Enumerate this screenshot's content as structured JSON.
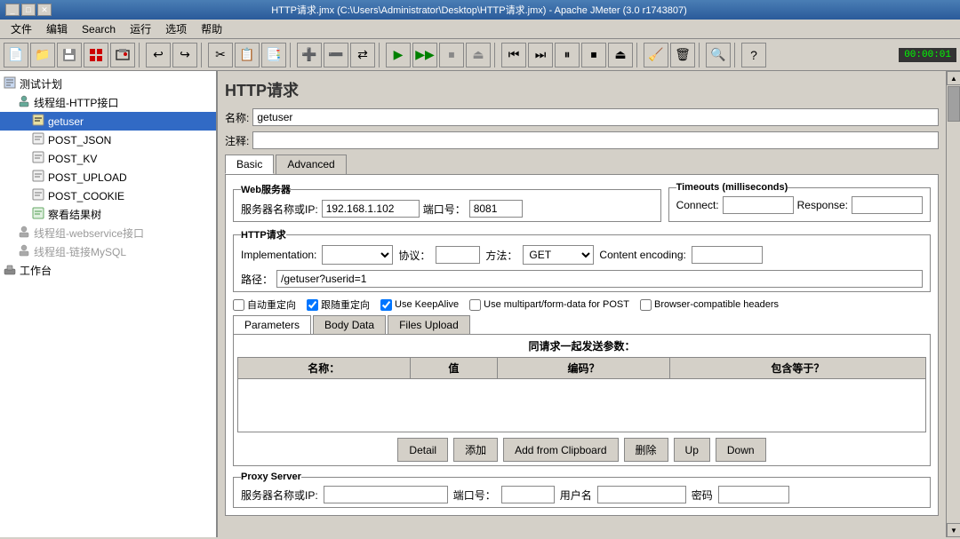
{
  "titleBar": {
    "text": "HTTP请求.jmx (C:\\Users\\Administrator\\Desktop\\HTTP请求.jmx) - Apache JMeter (3.0 r1743807)"
  },
  "menuBar": {
    "items": [
      "文件",
      "编辑",
      "Search",
      "运行",
      "选项",
      "帮助"
    ]
  },
  "toolbar": {
    "timer": "00:00:01",
    "buttons": [
      "📄",
      "💾",
      "⬆",
      "💾",
      "🖥",
      "↩",
      "↪",
      "✂",
      "📋",
      "📑",
      "➕",
      "➖",
      "⇄",
      "▶",
      "▶▶",
      "⏸",
      "⏹",
      "⏩",
      "⏮",
      "⏭",
      "⏸⏹",
      "🔍",
      "🔎",
      "📚",
      "🔑",
      "?"
    ]
  },
  "tree": {
    "nodes": [
      {
        "label": "测试计划",
        "indent": 0,
        "icon": "📋",
        "selected": false,
        "disabled": false
      },
      {
        "label": "线程组-HTTP接口",
        "indent": 1,
        "icon": "👥",
        "selected": false,
        "disabled": false
      },
      {
        "label": "getuser",
        "indent": 2,
        "icon": "📝",
        "selected": true,
        "disabled": false
      },
      {
        "label": "POST_JSON",
        "indent": 2,
        "icon": "📝",
        "selected": false,
        "disabled": false
      },
      {
        "label": "POST_KV",
        "indent": 2,
        "icon": "📝",
        "selected": false,
        "disabled": false
      },
      {
        "label": "POST_UPLOAD",
        "indent": 2,
        "icon": "📝",
        "selected": false,
        "disabled": false
      },
      {
        "label": "POST_COOKIE",
        "indent": 2,
        "icon": "📝",
        "selected": false,
        "disabled": false
      },
      {
        "label": "察看结果树",
        "indent": 2,
        "icon": "🌿",
        "selected": false,
        "disabled": false
      },
      {
        "label": "线程组-webservice接口",
        "indent": 1,
        "icon": "👥",
        "selected": false,
        "disabled": true
      },
      {
        "label": "线程组-链接MySQL",
        "indent": 1,
        "icon": "👥",
        "selected": false,
        "disabled": true
      },
      {
        "label": "工作台",
        "indent": 0,
        "icon": "🖥",
        "selected": false,
        "disabled": false
      }
    ]
  },
  "form": {
    "title": "HTTP请求",
    "nameLabel": "名称:",
    "nameValue": "getuser",
    "commentLabel": "注释:",
    "commentValue": "",
    "tabs": [
      {
        "label": "Basic",
        "active": true
      },
      {
        "label": "Advanced",
        "active": false
      }
    ],
    "webServer": {
      "sectionLabel": "Web服务器",
      "serverLabel": "服务器名称或IP:",
      "serverValue": "192.168.1.102",
      "portLabel": "端口号：",
      "portValue": "8081"
    },
    "timeouts": {
      "sectionLabel": "Timeouts (milliseconds)",
      "connectLabel": "Connect:",
      "connectValue": "",
      "responseLabel": "Response:",
      "responseValue": ""
    },
    "httpRequest": {
      "sectionLabel": "HTTP请求",
      "implementationLabel": "Implementation:",
      "implementationValue": "",
      "protocolLabel": "协议：",
      "protocolValue": "",
      "methodLabel": "方法：",
      "methodValue": "GET",
      "encodingLabel": "Content encoding:",
      "encodingValue": "",
      "pathLabel": "路径：",
      "pathValue": "/getuser?userid=1"
    },
    "checkboxes": [
      {
        "label": "自动重定向",
        "checked": false
      },
      {
        "label": "跟随重定向",
        "checked": true
      },
      {
        "label": "Use KeepAlive",
        "checked": true
      },
      {
        "label": "Use multipart/form-data for POST",
        "checked": false
      },
      {
        "label": "Browser-compatible headers",
        "checked": false
      }
    ],
    "subTabs": [
      {
        "label": "Parameters",
        "active": true
      },
      {
        "label": "Body Data",
        "active": false
      },
      {
        "label": "Files Upload",
        "active": false
      }
    ],
    "tableTitle": "同请求一起发送参数：",
    "tableColumns": [
      "名称：",
      "值",
      "编码？",
      "包含等于？"
    ],
    "tableRows": [],
    "buttons": {
      "detail": "Detail",
      "add": "添加",
      "addFromClipboard": "Add from Clipboard",
      "delete": "删除",
      "up": "Up",
      "down": "Down"
    },
    "proxyServer": {
      "sectionLabel": "Proxy Server",
      "serverLabel": "服务器名称或IP:",
      "serverValue": "",
      "portLabel": "端口号：",
      "portValue": "",
      "usernameLabel": "用户名",
      "usernameValue": "",
      "passwordLabel": "密码",
      "passwordValue": ""
    }
  }
}
